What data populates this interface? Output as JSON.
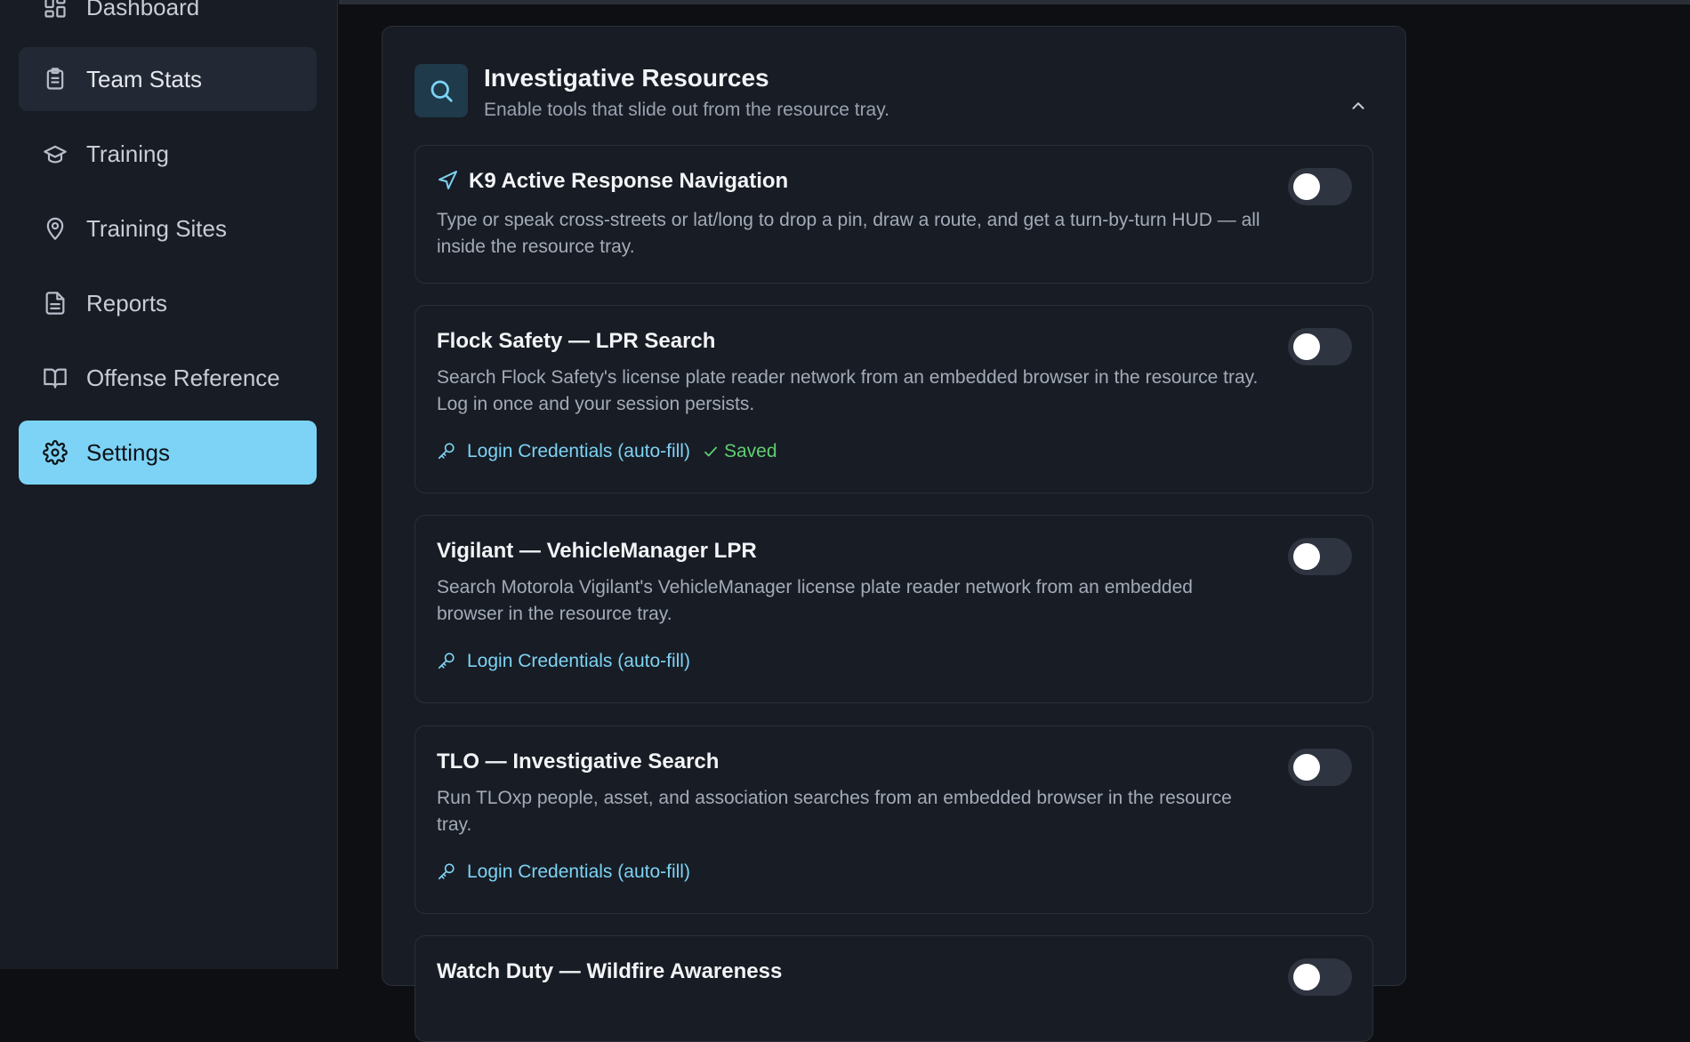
{
  "sidebar": {
    "items": [
      {
        "label": "Dashboard",
        "icon": "dashboard-icon"
      },
      {
        "label": "Team Stats",
        "icon": "clipboard-icon"
      },
      {
        "label": "Training",
        "icon": "graduation-cap-icon"
      },
      {
        "label": "Training Sites",
        "icon": "map-pin-icon"
      },
      {
        "label": "Reports",
        "icon": "file-text-icon"
      },
      {
        "label": "Offense Reference",
        "icon": "book-open-icon"
      },
      {
        "label": "Settings",
        "icon": "gear-icon"
      }
    ],
    "active": "Settings",
    "hovered": "Team Stats"
  },
  "panel": {
    "title": "Investigative Resources",
    "subtitle": "Enable tools that slide out from the resource tray.",
    "icon": "search-icon",
    "collapse_icon": "chevron-up-icon"
  },
  "resources": [
    {
      "title": "K9 Active Response Navigation",
      "icon": "navigation-arrow-icon",
      "description": "Type or speak cross-streets or lat/long to drop a pin, draw a route, and get a turn-by-turn HUD — all inside the resource tray.",
      "enabled": false
    },
    {
      "title": "Flock Safety — LPR Search",
      "description": "Search Flock Safety's license plate reader network from an embedded browser in the resource tray. Log in once and your session persists.",
      "credentials_label": "Login Credentials (auto-fill)",
      "saved_label": "Saved",
      "enabled": false
    },
    {
      "title": "Vigilant — VehicleManager LPR",
      "description": "Search Motorola Vigilant's VehicleManager license plate reader network from an embedded browser in the resource tray.",
      "credentials_label": "Login Credentials (auto-fill)",
      "enabled": false
    },
    {
      "title": "TLO — Investigative Search",
      "description": "Run TLOxp people, asset, and association searches from an embedded browser in the resource tray.",
      "credentials_label": "Login Credentials (auto-fill)",
      "enabled": false
    },
    {
      "title": "Watch Duty — Wildfire Awareness",
      "enabled": false
    }
  ],
  "colors": {
    "accent": "#7dd3f5",
    "background": "#0d0f13",
    "surface": "#181c24",
    "saved": "#5ecf72"
  }
}
